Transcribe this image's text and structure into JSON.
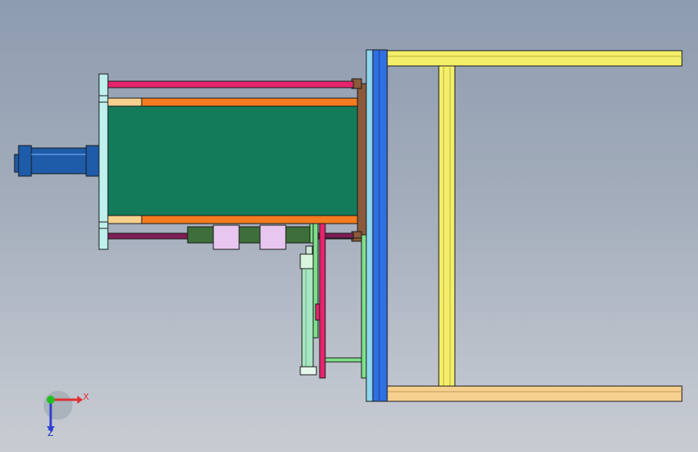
{
  "colors": {
    "background_top": "#8e9cb0",
    "background_bottom": "#c8ccd2",
    "yellow_frame": "#f4ef6a",
    "tan_frame": "#f5d08e",
    "blue_plate": "#2f6fe0",
    "light_blue_plate": "#8fd6ef",
    "brown_plate": "#8a5a3a",
    "green_box": "#137a5a",
    "orange_rail": "#f47b20",
    "magenta_rod": "#e6246e",
    "dark_magenta_rod": "#7d1f55",
    "motor_blue": "#1e5ba8",
    "pale_cyan": "#bff0ee",
    "lavender_block": "#e7c6f0",
    "dark_green_roller": "#3e6e3a",
    "light_green_bar": "#7ee08a",
    "axis_x": "#e03030",
    "axis_y": "#20c020",
    "axis_z": "#3040d0"
  },
  "triad": {
    "x_label": "X",
    "z_label": "Z"
  }
}
